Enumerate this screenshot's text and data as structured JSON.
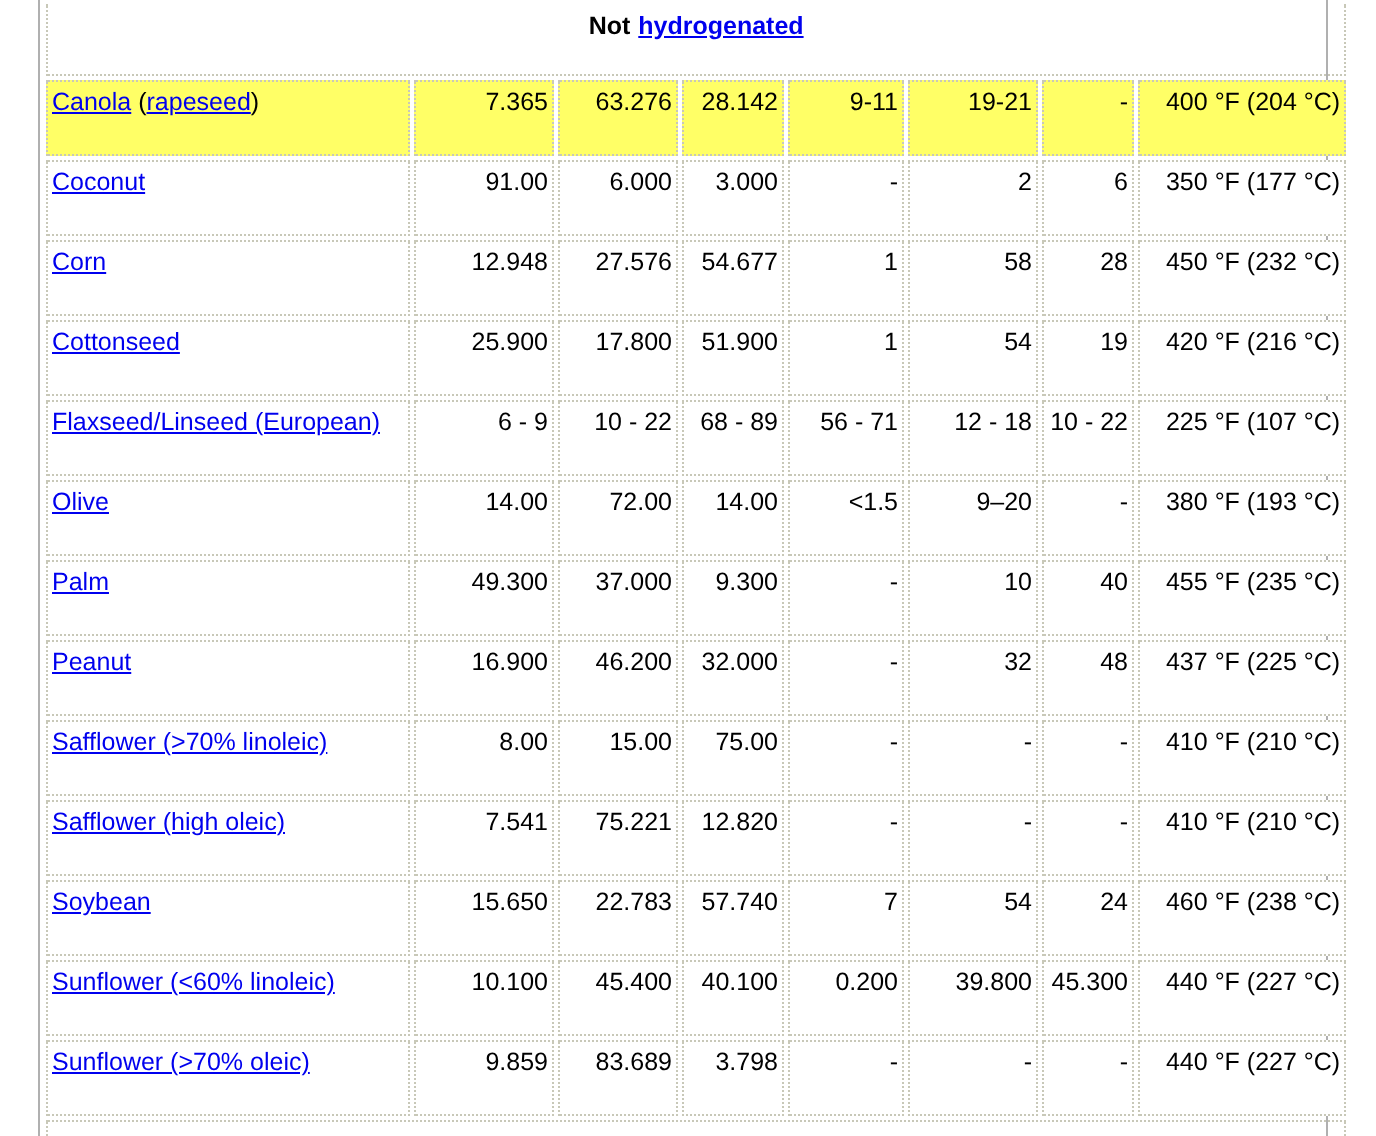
{
  "title": [
    {
      "text": "Not",
      "kind": "text"
    },
    {
      "text": "hydrogenated",
      "kind": "link"
    }
  ],
  "rows": [
    {
      "highlighted": true,
      "name": [
        {
          "text": "Canola",
          "kind": "link"
        },
        {
          "text": " (",
          "kind": "text"
        },
        {
          "text": "rapeseed",
          "kind": "link"
        },
        {
          "text": ")",
          "kind": "text"
        }
      ],
      "values": [
        "7.365",
        "63.276",
        "28.142",
        "9-11",
        "19-21",
        "-",
        "400 °F (204 °C)"
      ]
    },
    {
      "highlighted": false,
      "name": [
        {
          "text": "Coconut",
          "kind": "link"
        }
      ],
      "values": [
        "91.00",
        "6.000",
        "3.000",
        "-",
        "2",
        "6",
        "350 °F (177 °C)"
      ]
    },
    {
      "highlighted": false,
      "name": [
        {
          "text": "Corn",
          "kind": "link"
        }
      ],
      "values": [
        "12.948",
        "27.576",
        "54.677",
        "1",
        "58",
        "28",
        "450 °F (232 °C)"
      ]
    },
    {
      "highlighted": false,
      "name": [
        {
          "text": "Cottonseed",
          "kind": "link"
        }
      ],
      "values": [
        "25.900",
        "17.800",
        "51.900",
        "1",
        "54",
        "19",
        "420 °F (216 °C)"
      ]
    },
    {
      "highlighted": false,
      "name": [
        {
          "text": "Flaxseed/Linseed (European)",
          "kind": "link"
        }
      ],
      "values": [
        "6 - 9",
        "10 - 22",
        "68 - 89",
        "56 - 71",
        "12 - 18",
        "10 - 22",
        "225 °F (107 °C)"
      ]
    },
    {
      "highlighted": false,
      "name": [
        {
          "text": "Olive",
          "kind": "link"
        }
      ],
      "values": [
        "14.00",
        "72.00",
        "14.00",
        "<1.5",
        "9–20",
        "-",
        "380 °F (193 °C)"
      ]
    },
    {
      "highlighted": false,
      "name": [
        {
          "text": "Palm",
          "kind": "link"
        }
      ],
      "values": [
        "49.300",
        "37.000",
        "9.300",
        "-",
        "10",
        "40",
        "455 °F (235 °C)"
      ]
    },
    {
      "highlighted": false,
      "name": [
        {
          "text": "Peanut",
          "kind": "link"
        }
      ],
      "values": [
        "16.900",
        "46.200",
        "32.000",
        "-",
        "32",
        "48",
        "437 °F (225 °C)"
      ]
    },
    {
      "highlighted": false,
      "name": [
        {
          "text": "Safflower (>70% linoleic)",
          "kind": "link"
        }
      ],
      "values": [
        "8.00",
        "15.00",
        "75.00",
        "-",
        "-",
        "-",
        "410 °F (210 °C)"
      ]
    },
    {
      "highlighted": false,
      "name": [
        {
          "text": "Safflower (high oleic)",
          "kind": "link"
        }
      ],
      "values": [
        "7.541",
        "75.221",
        "12.820",
        "-",
        "-",
        "-",
        "410 °F (210 °C)"
      ]
    },
    {
      "highlighted": false,
      "name": [
        {
          "text": "Soybean",
          "kind": "link"
        }
      ],
      "values": [
        "15.650",
        "22.783",
        "57.740",
        "7",
        "54",
        "24",
        "460 °F (238 °C)"
      ]
    },
    {
      "highlighted": false,
      "name": [
        {
          "text": "Sunflower (<60% linoleic)",
          "kind": "link"
        }
      ],
      "values": [
        "10.100",
        "45.400",
        "40.100",
        "0.200",
        "39.800",
        "45.300",
        "440 °F (227 °C)"
      ]
    },
    {
      "highlighted": false,
      "name": [
        {
          "text": "Sunflower (>70% oleic)",
          "kind": "link"
        }
      ],
      "values": [
        "9.859",
        "83.689",
        "3.798",
        "-",
        "-",
        "-",
        "440 °F (227 °C)"
      ]
    }
  ]
}
